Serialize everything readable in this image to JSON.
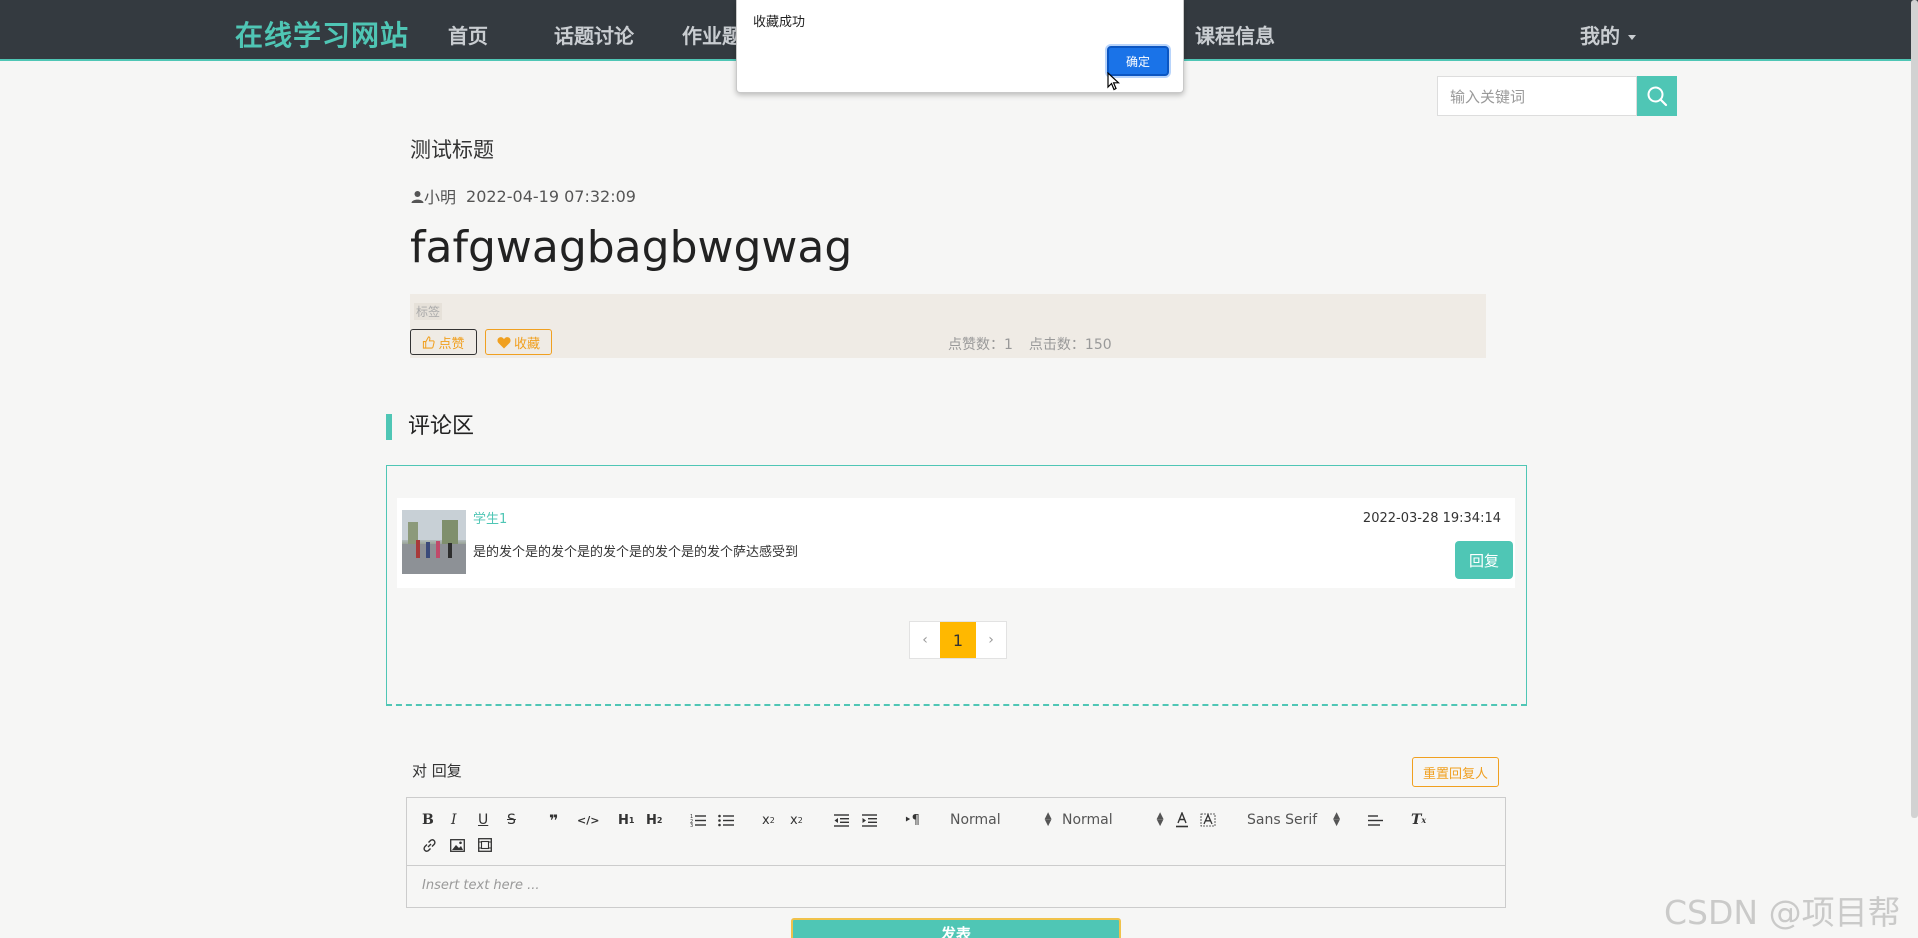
{
  "header": {
    "brand": "在线学习网站",
    "nav": [
      {
        "label": "首页"
      },
      {
        "label": "话题讨论"
      },
      {
        "label": "作业题"
      },
      {
        "label": "课程信息"
      }
    ],
    "me_label": "我的"
  },
  "dialog": {
    "message": "收藏成功",
    "ok_label": "确定"
  },
  "search": {
    "placeholder": "输入关键词"
  },
  "article": {
    "title": "测试标题",
    "author": "小明",
    "date": "2022-04-19 07:32:09",
    "content": "fafgwagbagbwgwag",
    "tag_label": "标签",
    "like_label": "点赞",
    "favorite_label": "收藏",
    "likes_text": "点赞数：1",
    "clicks_text": "点击数：150"
  },
  "comments": {
    "title": "评论区",
    "items": [
      {
        "user": "学生1",
        "text": "是的发个是的发个是的发个是的发个是的发个萨达感受到",
        "time": "2022-03-28 19:34:14",
        "reply_label": "回复"
      }
    ],
    "pager": {
      "prev": "‹",
      "current": "1",
      "next": "›"
    }
  },
  "reply": {
    "to_label": "对 回复",
    "reset_label": "重置回复人",
    "toolbar": {
      "header_select": "Normal",
      "size_select": "Normal",
      "font_select": "Sans Serif"
    },
    "placeholder": "Insert text here ...",
    "submit_label": "发表"
  },
  "watermark": "CSDN @项目帮",
  "colors": {
    "accent": "#4fc6b5",
    "nav_bg": "#343a40",
    "warning": "#f0a020",
    "pager_active": "#ffb800",
    "dialog_button": "#1a73e8"
  }
}
